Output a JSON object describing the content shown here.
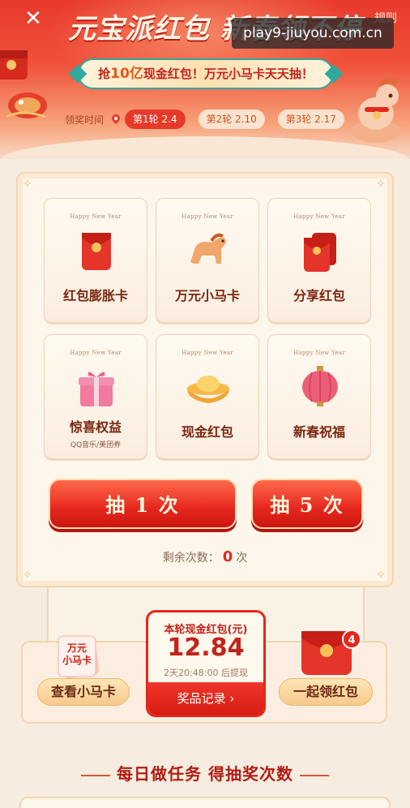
{
  "header": {
    "title": "元宝派红包 新春领不停",
    "rules": "规则",
    "watermark": "play9-jiuyou.com.cn",
    "banner_prefix": "抢",
    "banner_highlight": "10亿",
    "banner_suffix": "现金红包！万元小马卡天天抽！",
    "claim_time_label": "领奖时间",
    "rounds": [
      {
        "label": "第1轮 2.4",
        "active": true
      },
      {
        "label": "第2轮 2.10",
        "active": false
      },
      {
        "label": "第3轮 2.17",
        "active": false
      }
    ]
  },
  "prizes": [
    {
      "name": "红包膨胀卡",
      "sub": "",
      "icon": "red-envelope-icon",
      "caption": "Happy New Year"
    },
    {
      "name": "万元小马卡",
      "sub": "",
      "icon": "horse-icon",
      "caption": "Happy New Year"
    },
    {
      "name": "分享红包",
      "sub": "",
      "icon": "share-envelope-icon",
      "caption": "Happy New Year"
    },
    {
      "name": "惊喜权益",
      "sub": "QQ音乐/美团券",
      "icon": "gift-box-icon",
      "caption": "Happy New Year"
    },
    {
      "name": "现金红包",
      "sub": "",
      "icon": "gold-ingot-icon",
      "caption": "Happy New Year"
    },
    {
      "name": "新春祝福",
      "sub": "",
      "icon": "lantern-icon",
      "caption": "Happy New Year"
    }
  ],
  "draw": {
    "once_label": "抽 1 次",
    "five_label": "抽 5 次",
    "remain_prefix": "剩余次数：",
    "remain_count": "0",
    "remain_suffix": "次"
  },
  "bottom": {
    "left_card_text": "万元\n小马卡",
    "left_button": "查看小马卡",
    "center_label": "本轮现金红包(元)",
    "center_amount": "12.84",
    "countdown": "2天20:48:00 后提现",
    "records_button": "奖品记录 ›",
    "right_button": "一起领红包",
    "right_badge": "4"
  },
  "tasks": {
    "heading": "每日做任务 得抽奖次数"
  },
  "colors": {
    "primary_red": "#e5271c",
    "gold": "#f7c98c",
    "cream": "#fdf6ea"
  }
}
